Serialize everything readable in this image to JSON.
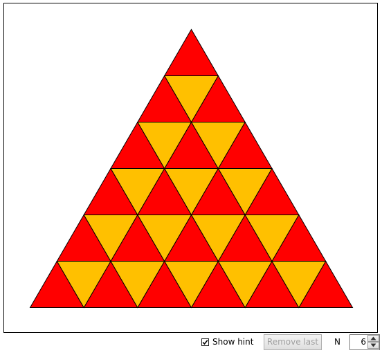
{
  "puzzle": {
    "n": 6,
    "colors": {
      "upright": "#ff0000",
      "inverted": "#ffc000",
      "outline": "#000000"
    }
  },
  "controls": {
    "show_hint": {
      "label": "Show hint",
      "checked": true
    },
    "remove_last": {
      "label": "Remove last",
      "enabled": false
    },
    "n_field": {
      "label": "N",
      "value": "6"
    },
    "icons": {
      "spinner_up": "triangle-up-icon",
      "spinner_down": "triangle-down-icon",
      "check": "checkmark-icon"
    }
  }
}
